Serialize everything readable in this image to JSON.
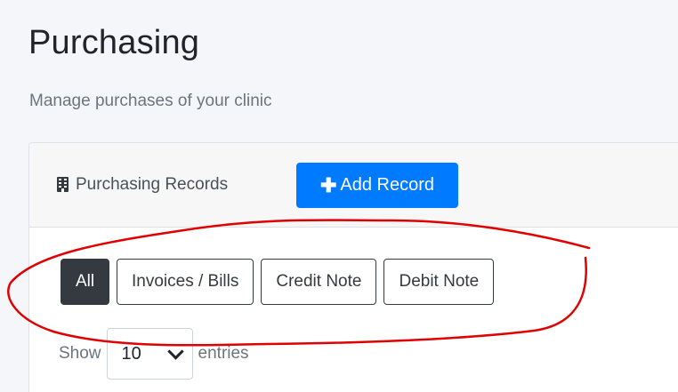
{
  "header": {
    "title": "Purchasing",
    "subtitle": "Manage purchases of your clinic"
  },
  "card": {
    "title": "Purchasing Records",
    "title_icon": "building-icon",
    "add_button": {
      "icon": "plus-icon",
      "label": "Add Record",
      "color": "#007bff"
    }
  },
  "filters": [
    {
      "label": "All",
      "active": true
    },
    {
      "label": "Invoices / Bills",
      "active": false
    },
    {
      "label": "Credit Note",
      "active": false
    },
    {
      "label": "Debit Note",
      "active": false
    }
  ],
  "entries": {
    "prefix": "Show",
    "value": "10",
    "suffix": "entries"
  },
  "annotation": {
    "shape": "hand-drawn-ellipse",
    "color": "#e00000"
  }
}
